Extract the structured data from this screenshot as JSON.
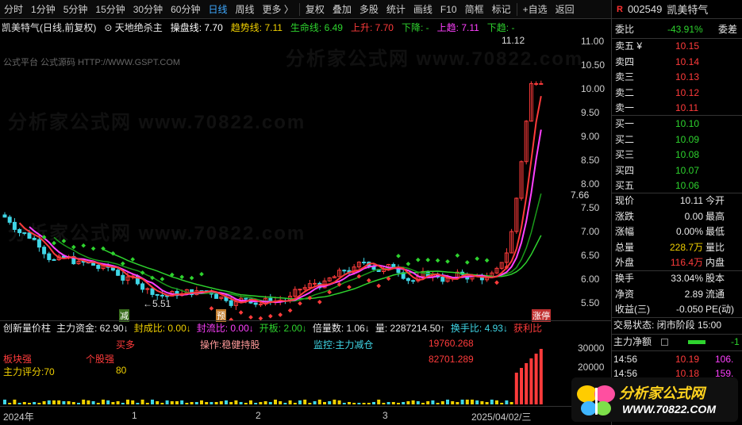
{
  "toolbar": {
    "items": [
      "分时",
      "1分钟",
      "5分钟",
      "15分钟",
      "30分钟",
      "60分钟",
      "日线",
      "周线",
      "更多 〉",
      "复权",
      "叠加",
      "多股",
      "统计",
      "画线",
      "F10",
      "简框",
      "标记",
      "+自选",
      "返回"
    ],
    "active": "日线"
  },
  "chart": {
    "stock_title": "凯美特气(日线,前复权)",
    "indicator_name": "天地绝杀主",
    "params": [
      {
        "label": "操盘线: 7.70",
        "color": "#ffffff"
      },
      {
        "label": "趋势线: 7.11",
        "color": "#f0d000"
      },
      {
        "label": "生命线: 6.49",
        "color": "#2ed32e"
      },
      {
        "label": "上升: 7.70",
        "color": "#ff3b3b"
      },
      {
        "label": "下降: -",
        "color": "#2ed32e"
      },
      {
        "label": "上趋: 7.11",
        "color": "#ff40ff"
      },
      {
        "label": "下趋: -",
        "color": "#2ed32e"
      }
    ],
    "subinfo": "公式平台 公式源码 HTTP://WWW.GSPT.COM",
    "price_ticks": [
      "11.00",
      "10.50",
      "10.00",
      "9.50",
      "9.00",
      "8.50",
      "8.00",
      "7.50",
      "7.00",
      "6.50",
      "6.00",
      "5.50"
    ],
    "current_price_tag": "7.66",
    "high_label": "11.12",
    "low_label": "5.51",
    "markers": [
      "减",
      "预",
      "涨停"
    ],
    "watermarks": [
      "分析家公式网 www.70822.com",
      "分析家公式网 www.70822.com",
      "分析家公式网 www.70822.com"
    ]
  },
  "indicator_row": {
    "items": [
      {
        "label": "创新量价柱",
        "color": "#e8e8e8"
      },
      {
        "label": "主力资金: 62.90↓",
        "color": "#e8e8e8"
      },
      {
        "label": "封成比: 0.00↓",
        "color": "#f0d000"
      },
      {
        "label": "封流比: 0.00↓",
        "color": "#ff40ff"
      },
      {
        "label": "开板: 2.00↓",
        "color": "#2ed32e"
      },
      {
        "label": "倍量数: 1.06↓",
        "color": "#e8e8e8"
      },
      {
        "label": "量: 2287214.50↑",
        "color": "#e8e8e8"
      },
      {
        "label": "换手比: 4.93↓",
        "color": "#3fd6e6"
      },
      {
        "label": "获利比",
        "color": "#ff3b3b"
      }
    ]
  },
  "sub_panel": {
    "labels": [
      {
        "text": "买多",
        "color": "#ff3b3b"
      },
      {
        "text": "操作:稳健持股",
        "color": "#ff9a9a"
      },
      {
        "text": "监控:主力减仓",
        "color": "#3fd6e6"
      },
      {
        "text": "19760.268",
        "color": "#ff3b3b"
      },
      {
        "text": "板块强",
        "color": "#ff3b3b"
      },
      {
        "text": "个股强",
        "color": "#ff3b3b"
      },
      {
        "text": "82701.289",
        "color": "#ff3b3b"
      },
      {
        "text": "主力评分:70",
        "color": "#f0d000"
      },
      {
        "text": "80",
        "color": "#f0d000"
      }
    ],
    "axis": [
      "30000",
      "20000"
    ]
  },
  "dates": [
    "2024年",
    "1",
    "2",
    "3",
    "2025/04/02/三"
  ],
  "quote": {
    "badge": "R",
    "code": "002549",
    "name": "凯美特气",
    "weibi_label": "委比",
    "weibi_value": "-43.91%",
    "weicha_label": "委差",
    "asks": [
      {
        "label": "卖五 ¥",
        "price": "10.15"
      },
      {
        "label": "卖四",
        "price": "10.14"
      },
      {
        "label": "卖三",
        "price": "10.13"
      },
      {
        "label": "卖二",
        "price": "10.12"
      },
      {
        "label": "卖一",
        "price": "10.11"
      }
    ],
    "bids": [
      {
        "label": "买一",
        "price": "10.10"
      },
      {
        "label": "买二",
        "price": "10.09"
      },
      {
        "label": "买三",
        "price": "10.08"
      },
      {
        "label": "买四",
        "price": "10.07"
      },
      {
        "label": "买五",
        "price": "10.06"
      }
    ],
    "stats": [
      {
        "label": "现价",
        "value": "10.11",
        "right": "今开",
        "color": "#e8e8e8"
      },
      {
        "label": "涨跌",
        "value": "0.00",
        "right": "最高",
        "color": "#e8e8e8"
      },
      {
        "label": "涨幅",
        "value": "0.00%",
        "right": "最低",
        "color": "#e8e8e8"
      },
      {
        "label": "总量",
        "value": "228.7万",
        "right": "量比",
        "color": "#f0d000"
      },
      {
        "label": "外盘",
        "value": "116.4万",
        "right": "内盘",
        "color": "#ff3b3b"
      }
    ],
    "stats2": [
      {
        "label": "换手",
        "value": "33.04%",
        "right": "股本",
        "color": "#e8e8e8"
      },
      {
        "label": "净资",
        "value": "2.89",
        "right": "流通",
        "color": "#e8e8e8"
      },
      {
        "label": "收益(三)",
        "value": "-0.050",
        "right": "PE(动)",
        "color": "#e8e8e8"
      }
    ],
    "trade_status": "交易状态: 闭市阶段 15:00",
    "main_net_label": "主力净额",
    "main_net_value": "-1",
    "ticks": [
      {
        "time": "14:56",
        "price": "10.19",
        "vol": "106."
      },
      {
        "time": "14:56",
        "price": "10.18",
        "vol": "159."
      }
    ]
  },
  "logo": {
    "title": "分析家公式网",
    "url": "WWW.70822.COM"
  }
}
